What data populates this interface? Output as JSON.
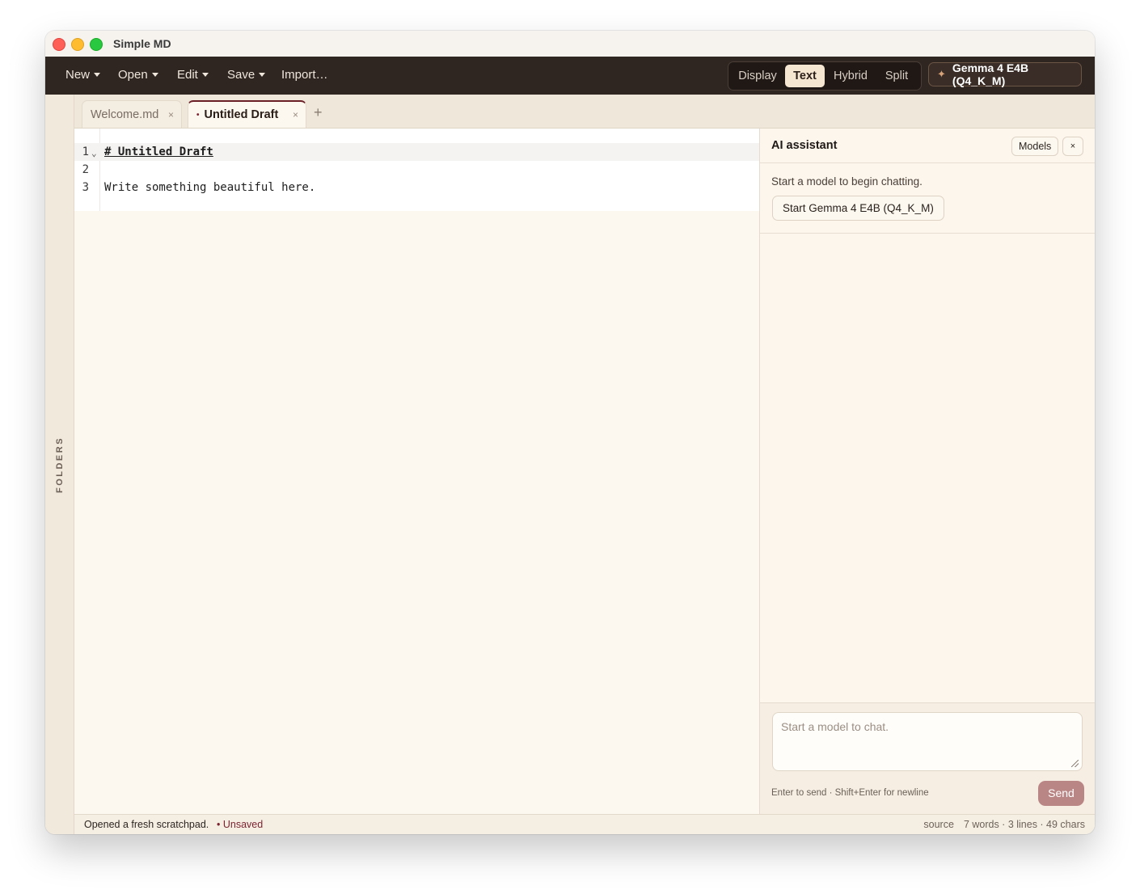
{
  "window": {
    "title": "Simple MD"
  },
  "toolbar": {
    "menus": [
      "New",
      "Open",
      "Edit",
      "Save"
    ],
    "import_label": "Import…",
    "view_modes": [
      "Display",
      "Text",
      "Hybrid",
      "Split"
    ],
    "active_view_mode": "Text",
    "model_label": "Gemma 4 E4B (Q4_K_M)"
  },
  "sidebar": {
    "folders_label": "FOLDERS"
  },
  "tabs": [
    {
      "label": "Welcome.md",
      "active": false
    },
    {
      "label": "Untitled Draft",
      "active": true,
      "unsaved_dot": "•"
    }
  ],
  "editor": {
    "lines": [
      {
        "number": "1",
        "text": "# Untitled Draft"
      },
      {
        "number": "2",
        "text": ""
      },
      {
        "number": "3",
        "text": "Write something beautiful here."
      }
    ]
  },
  "status": {
    "message": "Opened a fresh scratchpad.",
    "unsaved": "• Unsaved",
    "mode": "source",
    "stats": "7 words · 3 lines · 49 chars"
  },
  "ai": {
    "title": "AI assistant",
    "models_button": "Models",
    "close_glyph": "×",
    "hint": "Start a model to begin chatting.",
    "start_button": "Start Gemma 4 E4B (Q4_K_M)",
    "input_placeholder": "Start a model to chat.",
    "help": "Enter to send · Shift+Enter for newline",
    "send": "Send"
  },
  "colors": {
    "toolbar_bg": "#2f2521",
    "accent": "#6b1f27",
    "send_button": "#b98685",
    "editor_bg": "#fdf8ef"
  }
}
